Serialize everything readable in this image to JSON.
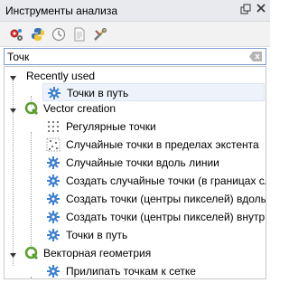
{
  "panel": {
    "title": "Инструменты анализа"
  },
  "toolbar": {
    "icons": [
      "models-icon",
      "python-icon",
      "history-icon",
      "results-icon",
      "options-icon"
    ]
  },
  "search": {
    "value": "Точк",
    "placeholder": ""
  },
  "tree": {
    "groups": [
      {
        "label": "Recently used",
        "items": [
          {
            "label": "Точки в путь",
            "icon": "gear-icon",
            "selected": true
          }
        ]
      },
      {
        "label": "Vector creation",
        "items": [
          {
            "label": "Регулярные точки",
            "icon": "regular-points-icon"
          },
          {
            "label": "Случайные точки в пределах экстента",
            "icon": "random-points-icon"
          },
          {
            "label": "Случайные точки вдоль линии",
            "icon": "gear-icon"
          },
          {
            "label": "Создать случайные точки (в границах сл...",
            "icon": "gear-icon"
          },
          {
            "label": "Создать точки (центры пикселей) вдоль ...",
            "icon": "gear-icon"
          },
          {
            "label": "Создать точки (центры пикселей) внутр...",
            "icon": "gear-icon"
          },
          {
            "label": "Точки в путь",
            "icon": "gear-icon"
          }
        ]
      },
      {
        "label": "Векторная геометрия",
        "items": [
          {
            "label": "Прилипать точкам к сетке",
            "icon": "gear-icon"
          }
        ]
      }
    ]
  },
  "colors": {
    "qgis_green": "#5a9e2f",
    "gear_blue": "#3b7fcf",
    "selection": "#eef3fb"
  }
}
